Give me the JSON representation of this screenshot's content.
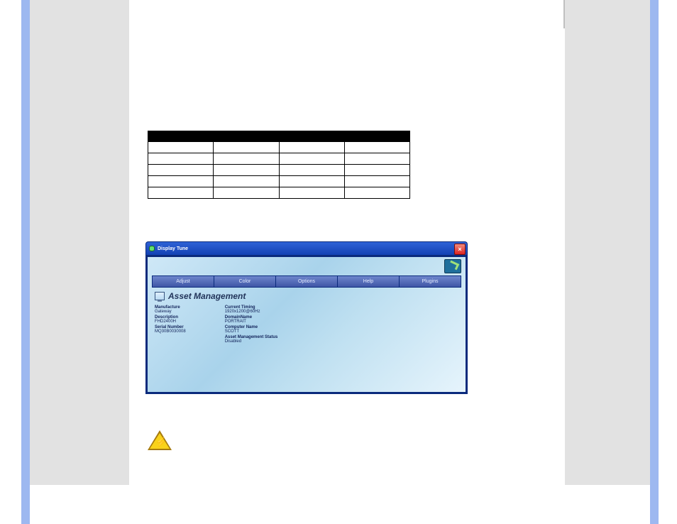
{
  "app_window": {
    "title": "Display Tune",
    "close_label": "×",
    "tabs": [
      "Adjust",
      "Color",
      "Options",
      "Help",
      "Plugins"
    ],
    "panel_title": "Asset Management",
    "columns": {
      "left": {
        "manufacture_label": "Manufacture",
        "manufacture_value": "Gateway",
        "description_label": "Description",
        "description_value": "FHD2400H",
        "serial_label": "Serial Number",
        "serial_value": "MQ30B0030008"
      },
      "right": {
        "timing_label": "Current Timing",
        "timing_value": "1920x1200@60Hz",
        "domain_label": "DomainName",
        "domain_value": "PORTRAIT",
        "computer_label": "Computer Name",
        "computer_value": "SCOTT",
        "am_status_label": "Asset Management Status",
        "am_status_value": "Disabled"
      }
    }
  },
  "table": {
    "header_cells": 4,
    "body_rows": 5,
    "body_cols": 4
  }
}
